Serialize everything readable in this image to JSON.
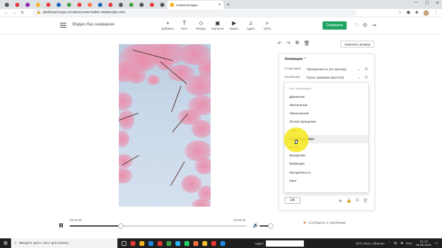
{
  "browser": {
    "active_tab_title": "Новая вкладка",
    "url": "dashboard.supa.ru/video/create?width=360&height=640"
  },
  "header": {
    "doc_title": "Видео без названия",
    "tools": [
      {
        "icon": "plus-icon",
        "glyph": "+",
        "label": "Добавить"
      },
      {
        "icon": "text-icon",
        "glyph": "T",
        "label": "Текст"
      },
      {
        "icon": "shapes-icon",
        "glyph": "◇",
        "label": "Фигура"
      },
      {
        "icon": "image-icon",
        "glyph": "▣",
        "label": "Картинка"
      },
      {
        "icon": "video-icon",
        "glyph": "▶",
        "label": "Видео"
      },
      {
        "icon": "music-icon",
        "glyph": "♫",
        "label": "Аудио"
      },
      {
        "icon": "zoom-icon",
        "glyph": "⌕",
        "label": "100%"
      }
    ],
    "save_label": "Сохранить"
  },
  "right_panel": {
    "resize_label": "Изменить размер",
    "title": "Анимация",
    "start_label": "Стартовая:",
    "start_value": "Прозрачность (по центру)",
    "main_label": "Основная:",
    "main_value": "Пульс размера (высота)",
    "ok_label": "OK"
  },
  "dropdown": {
    "items": [
      {
        "label": "Нет анимации",
        "state": "muted"
      },
      {
        "label": "Движение",
        "state": ""
      },
      {
        "label": "Увеличение",
        "state": ""
      },
      {
        "label": "Уменьшение",
        "state": ""
      },
      {
        "label": "Легкое вращение",
        "state": ""
      },
      {
        "label": "Пульс",
        "state": ""
      },
      {
        "label": "Пульс размера",
        "state": "sel"
      },
      {
        "label": "Волна",
        "state": ""
      },
      {
        "label": "Вращение",
        "state": ""
      },
      {
        "label": "Вибрация",
        "state": ""
      },
      {
        "label": "Прозрачность",
        "state": ""
      },
      {
        "label": "Пинг",
        "state": ""
      }
    ]
  },
  "player": {
    "current_time": "00:01.60",
    "total_time": "00:05.00",
    "progress_fraction": 0.29,
    "volume_fraction": 0.95,
    "report_label": "Сообщить о проблеме"
  },
  "taskbar": {
    "search_placeholder": "Введите здесь текст для поиска",
    "address_label": "Адрес",
    "weather": "18°C Ясно, облачно",
    "lang": "РУС",
    "time": "21:13",
    "date": "29.06.2021"
  }
}
